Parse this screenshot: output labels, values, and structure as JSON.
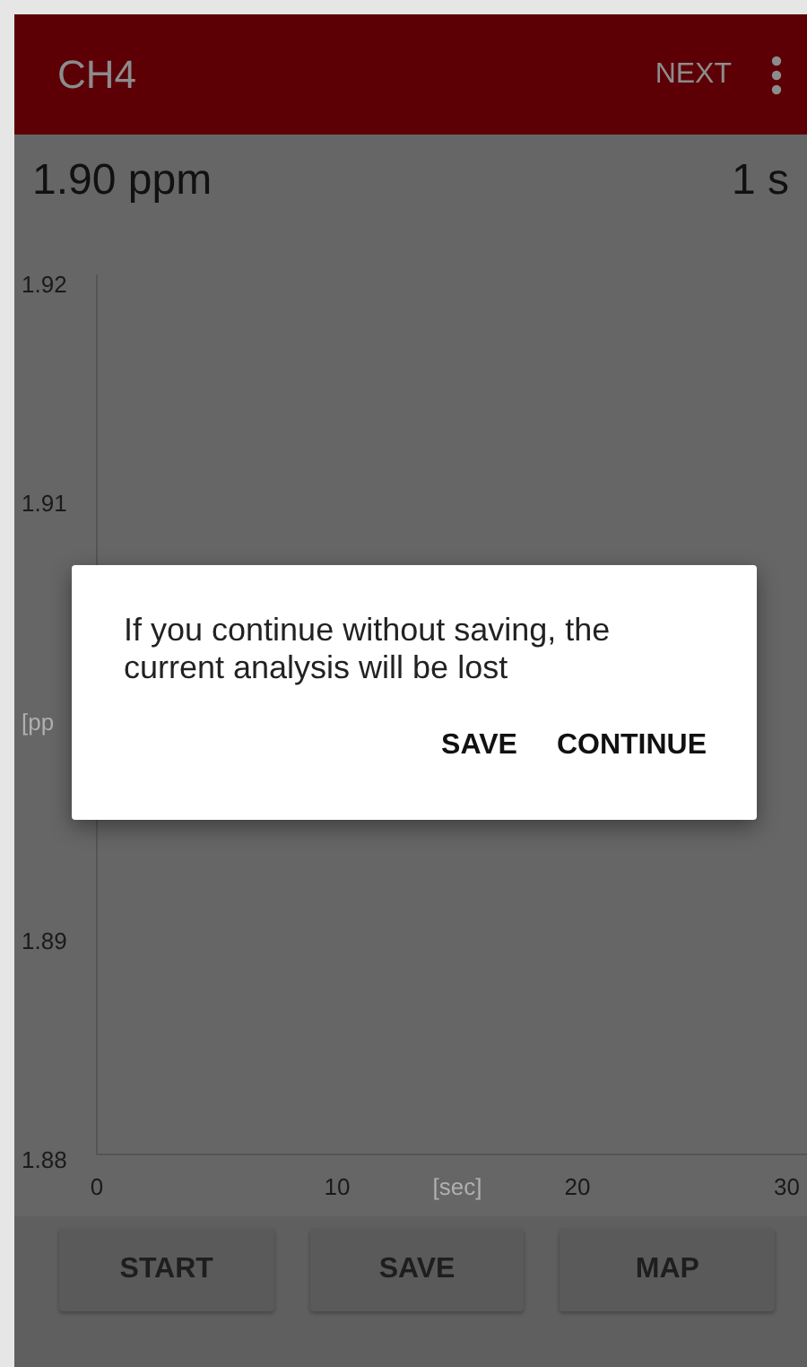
{
  "app_bar": {
    "title": "CH4",
    "action": "NEXT"
  },
  "reading": {
    "value": "1.90 ppm",
    "interval": "1 s"
  },
  "chart": {
    "chart_data": {
      "type": "line",
      "xlabel": "[sec]",
      "ylabel": "[pp",
      "xlim": [
        0,
        30
      ],
      "ylim": [
        1.88,
        1.92
      ],
      "xticks": [
        0,
        10,
        20,
        30
      ],
      "yticks": [
        1.88,
        1.89,
        1.91,
        1.92
      ]
    }
  },
  "buttons": [
    "START",
    "SAVE",
    "MAP"
  ],
  "dialog": {
    "message": "If you continue without saving, the current analysis will be lost",
    "buttons": [
      "SAVE",
      "CONTINUE"
    ]
  }
}
